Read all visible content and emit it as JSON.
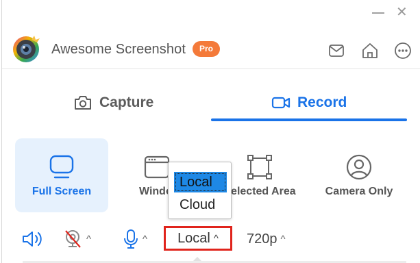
{
  "window": {
    "minimize_icon": "minimize-icon",
    "close_icon": "close-icon",
    "close_glyph": "✕"
  },
  "header": {
    "app_name": "Awesome Screenshot",
    "badge": "Pro",
    "icons": [
      "mail-icon",
      "home-icon",
      "more-icon"
    ]
  },
  "tabs": [
    {
      "label": "Capture",
      "icon": "camera-icon",
      "active": false
    },
    {
      "label": "Record",
      "icon": "video-camera-icon",
      "active": true
    }
  ],
  "modes": [
    {
      "label": "Full Screen",
      "icon": "monitor-icon",
      "active": true
    },
    {
      "label": "Windo",
      "icon": "window-icon",
      "active": false
    },
    {
      "label": "Selected Area",
      "icon": "selection-icon",
      "active": false
    },
    {
      "label": "Camera Only",
      "icon": "user-icon",
      "active": false
    }
  ],
  "dropdown": {
    "options": [
      "Local",
      "Cloud"
    ],
    "selected": "Local"
  },
  "toolbar": {
    "storage_value": "Local",
    "resolution_value": "720p",
    "caret": "^"
  },
  "colors": {
    "accent": "#1a73e8",
    "active_bg": "#e6f1fd",
    "pro_badge": "#f47a3a",
    "highlight_border": "#e0241c",
    "dropdown_selection": "#1e88e5"
  }
}
